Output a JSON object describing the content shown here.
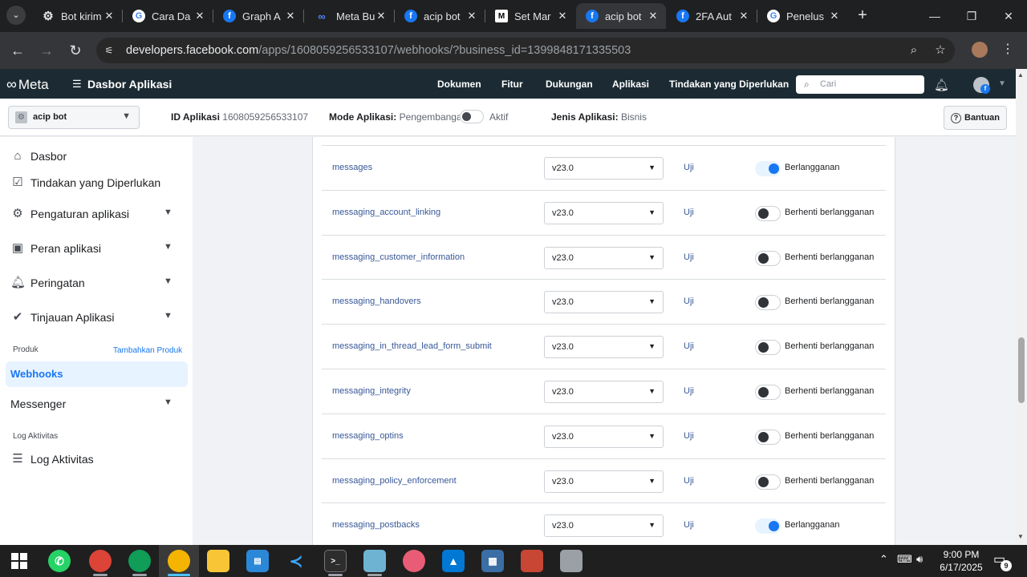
{
  "browser": {
    "tabs": [
      {
        "title": "Bot kirim",
        "favicon": "gear-icon"
      },
      {
        "title": "Cara Da",
        "favicon": "google-icon"
      },
      {
        "title": "Graph A",
        "favicon": "facebook-icon"
      },
      {
        "title": "Meta Bu",
        "favicon": "meta-icon"
      },
      {
        "title": "acip bot",
        "favicon": "facebook-icon"
      },
      {
        "title": "Set Mar",
        "favicon": "medium-icon"
      },
      {
        "title": "acip bot",
        "favicon": "facebook-icon",
        "active": true
      },
      {
        "title": "2FA Aut",
        "favicon": "facebook-icon"
      },
      {
        "title": "Penelus",
        "favicon": "google-icon"
      }
    ],
    "url_host": "developers.facebook.com",
    "url_path": "/apps/1608059256533107/webhooks/?business_id=1399848171335503"
  },
  "meta_header": {
    "logo": "Meta",
    "app_dashboard": "Dasbor Aplikasi",
    "nav": [
      "Dokumen",
      "Fitur",
      "Dukungan",
      "Aplikasi",
      "Tindakan yang Diperlukan"
    ],
    "search_placeholder": "Cari",
    "avatar_badge": "f"
  },
  "appbar": {
    "app_name": "acip bot",
    "app_id_label": "ID Aplikasi",
    "app_id": "1608059256533107",
    "mode_label": "Mode Aplikasi:",
    "mode_dev": "Pengembangan",
    "mode_live": "Aktif",
    "type_label": "Jenis Aplikasi:",
    "type_value": "Bisnis",
    "help": "Bantuan"
  },
  "sidebar": {
    "items": [
      {
        "label": "Dasbor",
        "icon": "home-icon"
      },
      {
        "label": "Tindakan yang Diperlukan",
        "icon": "checklist-icon"
      },
      {
        "label": "Pengaturan aplikasi",
        "icon": "gear-icon"
      },
      {
        "label": "Peran aplikasi",
        "icon": "id-badge-icon"
      },
      {
        "label": "Peringatan",
        "icon": "bell-icon"
      },
      {
        "label": "Tinjauan Aplikasi",
        "icon": "shield-check-icon"
      }
    ],
    "products_label": "Produk",
    "add_product": "Tambahkan Produk",
    "webhooks": "Webhooks",
    "messenger": "Messenger",
    "activity_section": "Log Aktivitas",
    "activity_item": "Log Aktivitas"
  },
  "webhook_fields": [
    {
      "name": "messages",
      "version": "v23.0",
      "test": "Uji",
      "subscribed": true,
      "status": "Berlangganan"
    },
    {
      "name": "messaging_account_linking",
      "version": "v23.0",
      "test": "Uji",
      "subscribed": false,
      "status": "Berhenti berlangganan"
    },
    {
      "name": "messaging_customer_information",
      "version": "v23.0",
      "test": "Uji",
      "subscribed": false,
      "status": "Berhenti berlangganan"
    },
    {
      "name": "messaging_handovers",
      "version": "v23.0",
      "test": "Uji",
      "subscribed": false,
      "status": "Berhenti berlangganan"
    },
    {
      "name": "messaging_in_thread_lead_form_submit",
      "version": "v23.0",
      "test": "Uji",
      "subscribed": false,
      "status": "Berhenti berlangganan"
    },
    {
      "name": "messaging_integrity",
      "version": "v23.0",
      "test": "Uji",
      "subscribed": false,
      "status": "Berhenti berlangganan"
    },
    {
      "name": "messaging_optins",
      "version": "v23.0",
      "test": "Uji",
      "subscribed": false,
      "status": "Berhenti berlangganan"
    },
    {
      "name": "messaging_policy_enforcement",
      "version": "v23.0",
      "test": "Uji",
      "subscribed": false,
      "status": "Berhenti berlangganan"
    },
    {
      "name": "messaging_postbacks",
      "version": "v23.0",
      "test": "Uji",
      "subscribed": true,
      "status": "Berlangganan"
    }
  ],
  "taskbar": {
    "time": "9:00 PM",
    "date": "6/17/2025",
    "notifications": "9"
  },
  "colors": {
    "accent": "#1877f2",
    "meta_header_bg": "#1c2b33",
    "link": "#385898"
  }
}
